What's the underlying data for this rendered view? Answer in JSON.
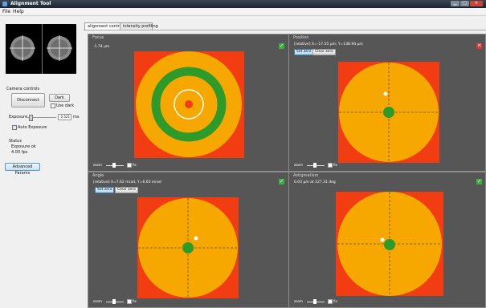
{
  "window": {
    "title": "Alignment Tool",
    "min_glyph": "▁",
    "max_glyph": "□",
    "close_glyph": "✕"
  },
  "menu": [
    "File",
    "Help"
  ],
  "left": {
    "camera_controls_label": "Camera controls",
    "disconnect_label": "Disconnect",
    "dark_label": "Dark",
    "use_dark_label": "Use dark",
    "exposure_label": "Exposure",
    "exposure_value": "0.521",
    "exposure_unit": "ms",
    "auto_exposure_label": "Auto Exposure",
    "status_label": "Status",
    "status_line1": "Exposure ok",
    "status_line2": "4.00 fps",
    "advanced_label": "Advanced Params"
  },
  "tabs": [
    "alignment controls",
    "intensity profiling"
  ],
  "panels": {
    "focus": {
      "title": "Focus",
      "info": "-1.74 µm",
      "status_glyph": "✓"
    },
    "position": {
      "title": "Position",
      "info": "[relative] X=-17.55 µm, Y=138.94 µm",
      "set_zero": "Set zero",
      "clear_zero": "Clear zero",
      "status_glyph": "✕"
    },
    "angle": {
      "title": "Angle",
      "info": "[relative] X=7.62 mrad, Y=6.63 mrad",
      "set_zero": "Set zero",
      "clear_zero": "Clear zero",
      "status_glyph": "✓"
    },
    "astigmatism": {
      "title": "Astigmatism",
      "info": "0.03 µm at 127.31 deg",
      "status_glyph": "✓"
    }
  },
  "footer": {
    "zoom_label": "zoom",
    "fix_label": "fix"
  },
  "colors": {
    "orange": "#f6a800",
    "red": "#f23c12",
    "green": "#2e9a2a",
    "panel_bg": "#565656",
    "ok": "#3bb03b",
    "bad": "#e0322a"
  }
}
